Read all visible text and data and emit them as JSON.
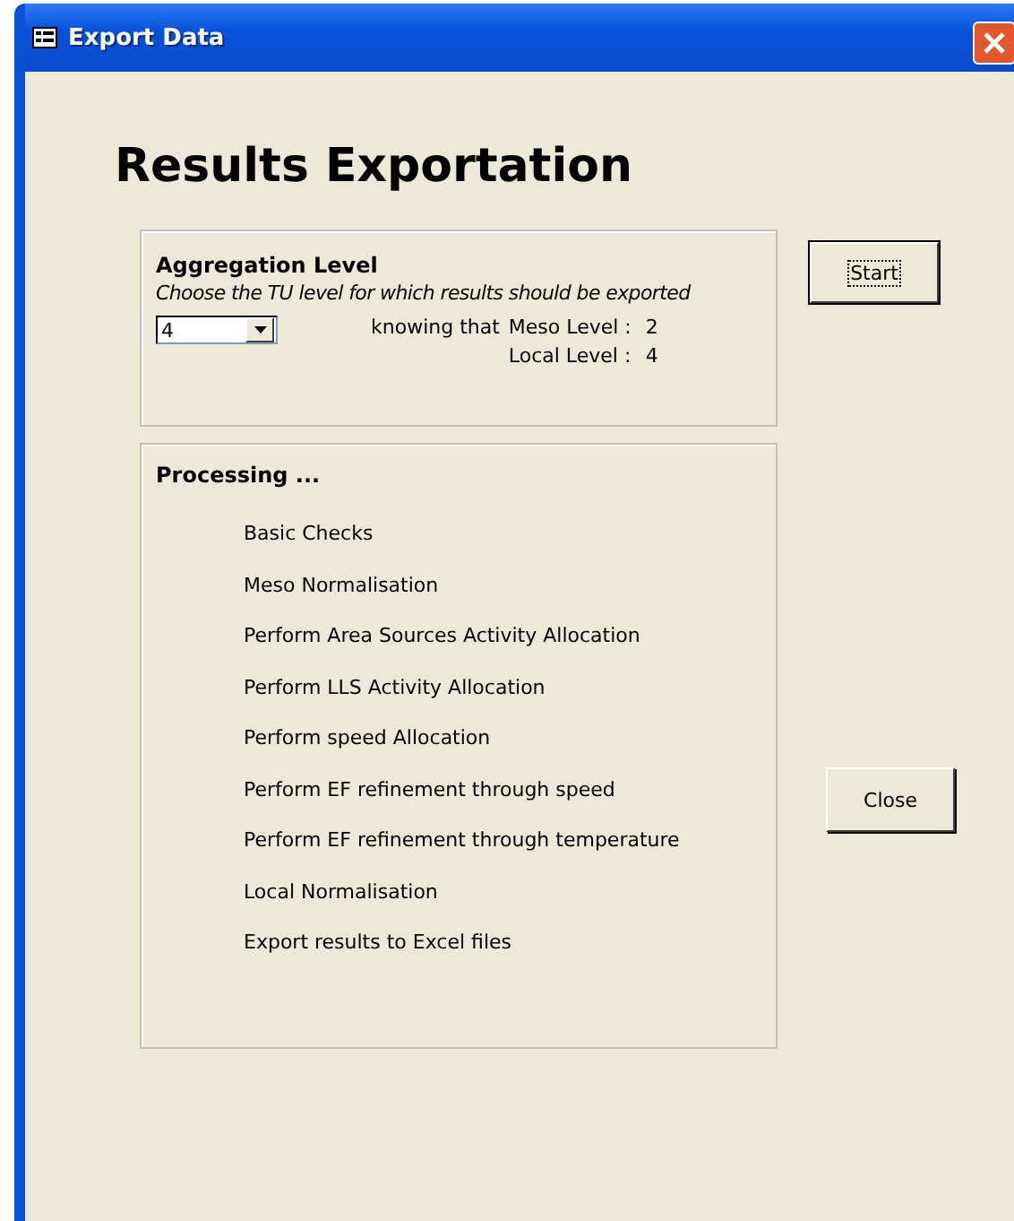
{
  "window": {
    "title": "Export Data"
  },
  "heading": "Results Exportation",
  "aggregation": {
    "title": "Aggregation Level",
    "hint": "Choose the TU level for which results should be exported",
    "level_select": {
      "value": "4"
    },
    "knowing": "knowing that",
    "meso_label": "Meso Level :",
    "meso_value": "2",
    "local_label": "Local Level :",
    "local_value": "4"
  },
  "processing": {
    "title": "Processing ...",
    "steps": [
      "Basic Checks",
      "Meso Normalisation",
      "Perform Area Sources Activity Allocation",
      "Perform LLS Activity Allocation",
      "Perform speed Allocation",
      "Perform EF refinement through speed",
      "Perform EF refinement through temperature",
      "Local Normalisation",
      "Export results to Excel files"
    ]
  },
  "buttons": {
    "start": "Start",
    "close": "Close"
  }
}
